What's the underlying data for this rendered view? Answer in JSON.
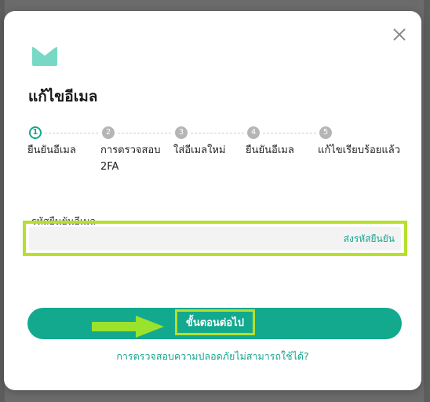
{
  "dialog": {
    "title": "แก้ไขอีเมล",
    "steps": [
      {
        "number": "1",
        "label": "ยืนยันอีเมล",
        "state": "active"
      },
      {
        "number": "2",
        "label": "การตรวจสอบ 2FA",
        "state": "inactive"
      },
      {
        "number": "3",
        "label": "ใส่อีเมลใหม่",
        "state": "inactive"
      },
      {
        "number": "4",
        "label": "ยืนยันอีเมล",
        "state": "inactive"
      },
      {
        "number": "5",
        "label": "แก้ไขเรียบร้อยแล้ว",
        "state": "inactive"
      }
    ],
    "field": {
      "label": "รหัสยืนยันอีเมล",
      "value": "",
      "placeholder": "",
      "send_code": "ส่งรหัสยืนยัน"
    },
    "next_button": "ขั้นตอนต่อไป",
    "help_link": "การตรวจสอบความปลอดภัยไม่สามารถใช้ได้?"
  },
  "colors": {
    "accent": "#12a98f",
    "highlight": "#b7df2b",
    "arrow": "#9be22d"
  },
  "icons": {
    "header": "mail-icon",
    "close": "close-icon",
    "annotation": "arrow-right-icon"
  }
}
